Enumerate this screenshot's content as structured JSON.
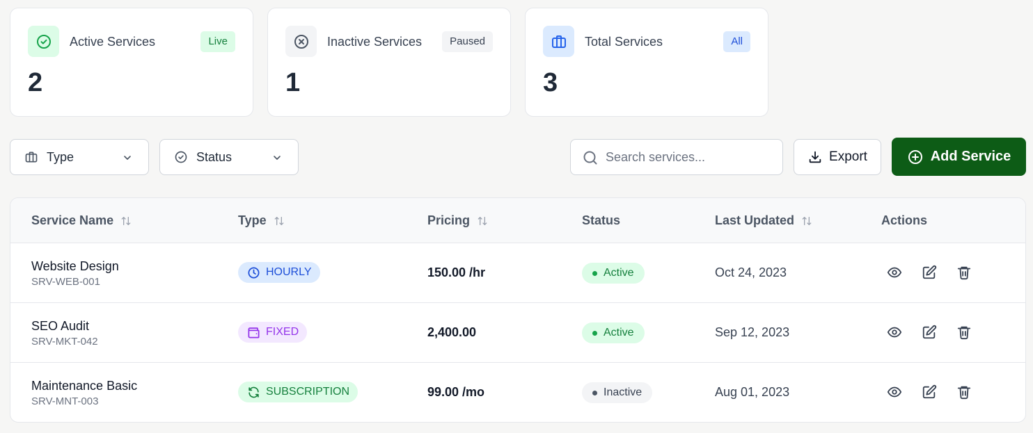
{
  "stats": [
    {
      "label": "Active Services",
      "badge": "Live",
      "value": "2"
    },
    {
      "label": "Inactive Services",
      "badge": "Paused",
      "value": "1"
    },
    {
      "label": "Total Services",
      "badge": "All",
      "value": "3"
    }
  ],
  "filters": {
    "type_label": "Type",
    "status_label": "Status"
  },
  "search": {
    "placeholder": "Search services..."
  },
  "toolbar": {
    "export_label": "Export",
    "add_label": "Add Service"
  },
  "table": {
    "headers": [
      "Service Name",
      "Type",
      "Pricing",
      "Status",
      "Last Updated",
      "Actions"
    ],
    "rows": [
      {
        "name": "Website Design",
        "code": "SRV-WEB-001",
        "type": "HOURLY",
        "pricing": "150.00 /hr",
        "status": "Active",
        "updated": "Oct 24, 2023"
      },
      {
        "name": "SEO Audit",
        "code": "SRV-MKT-042",
        "type": "FIXED",
        "pricing": "2,400.00",
        "status": "Active",
        "updated": "Sep 12, 2023"
      },
      {
        "name": "Maintenance Basic",
        "code": "SRV-MNT-003",
        "type": "SUBSCRIPTION",
        "pricing": "99.00 /mo",
        "status": "Inactive",
        "updated": "Aug 01, 2023"
      }
    ]
  },
  "icons": [
    "check-circle-icon",
    "x-circle-icon",
    "briefcase-icon",
    "chevron-down-icon",
    "search-icon",
    "download-icon",
    "plus-circle-icon",
    "sort-icon",
    "clock-icon",
    "wallet-icon",
    "refresh-icon",
    "eye-icon",
    "edit-icon",
    "trash-icon"
  ],
  "colors": {
    "primary": "#0d5c16",
    "live_bg": "#dcfce7",
    "live_text": "#15803d",
    "paused_bg": "#f3f4f6",
    "all_bg": "#dbeafe",
    "all_text": "#1d4ed8"
  }
}
